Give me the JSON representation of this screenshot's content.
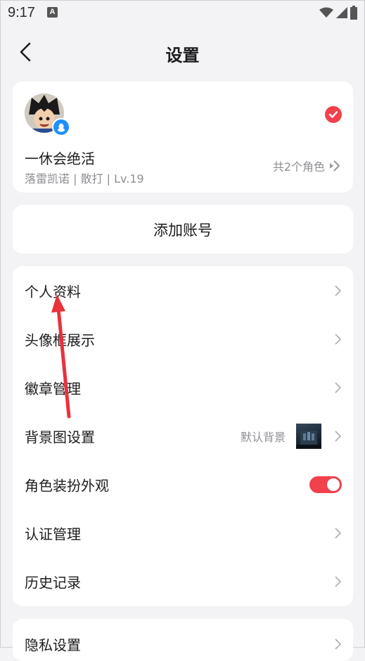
{
  "status_bar": {
    "time": "9:17",
    "notification_glyph": "A",
    "icons": [
      "wifi-icon",
      "signal-icon",
      "battery-icon"
    ]
  },
  "nav": {
    "title": "设置",
    "back_icon": "chevron-left-icon"
  },
  "account": {
    "name": "一休会绝活",
    "sub": "落雷凯诺 | 散打 | Lv.19",
    "role_count": "共2个角色",
    "selected": true,
    "avatar_badge_icon": "qq-penguin-icon"
  },
  "add_account": {
    "label": "添加账号"
  },
  "menu": {
    "items": [
      {
        "label": "个人资料",
        "type": "link"
      },
      {
        "label": "头像框展示",
        "type": "link"
      },
      {
        "label": "徽章管理",
        "type": "link"
      },
      {
        "label": "背景图设置",
        "type": "link",
        "value": "默认背景"
      },
      {
        "label": "角色装扮外观",
        "type": "toggle",
        "toggle_on": true
      },
      {
        "label": "认证管理",
        "type": "link"
      },
      {
        "label": "历史记录",
        "type": "link"
      }
    ]
  },
  "privacy": {
    "label": "隐私设置"
  },
  "colors": {
    "accent": "#f0414d",
    "background": "#f3f3f5",
    "card": "#ffffff",
    "muted_text": "#8e8e93",
    "annotation_arrow": "#e8323c"
  }
}
